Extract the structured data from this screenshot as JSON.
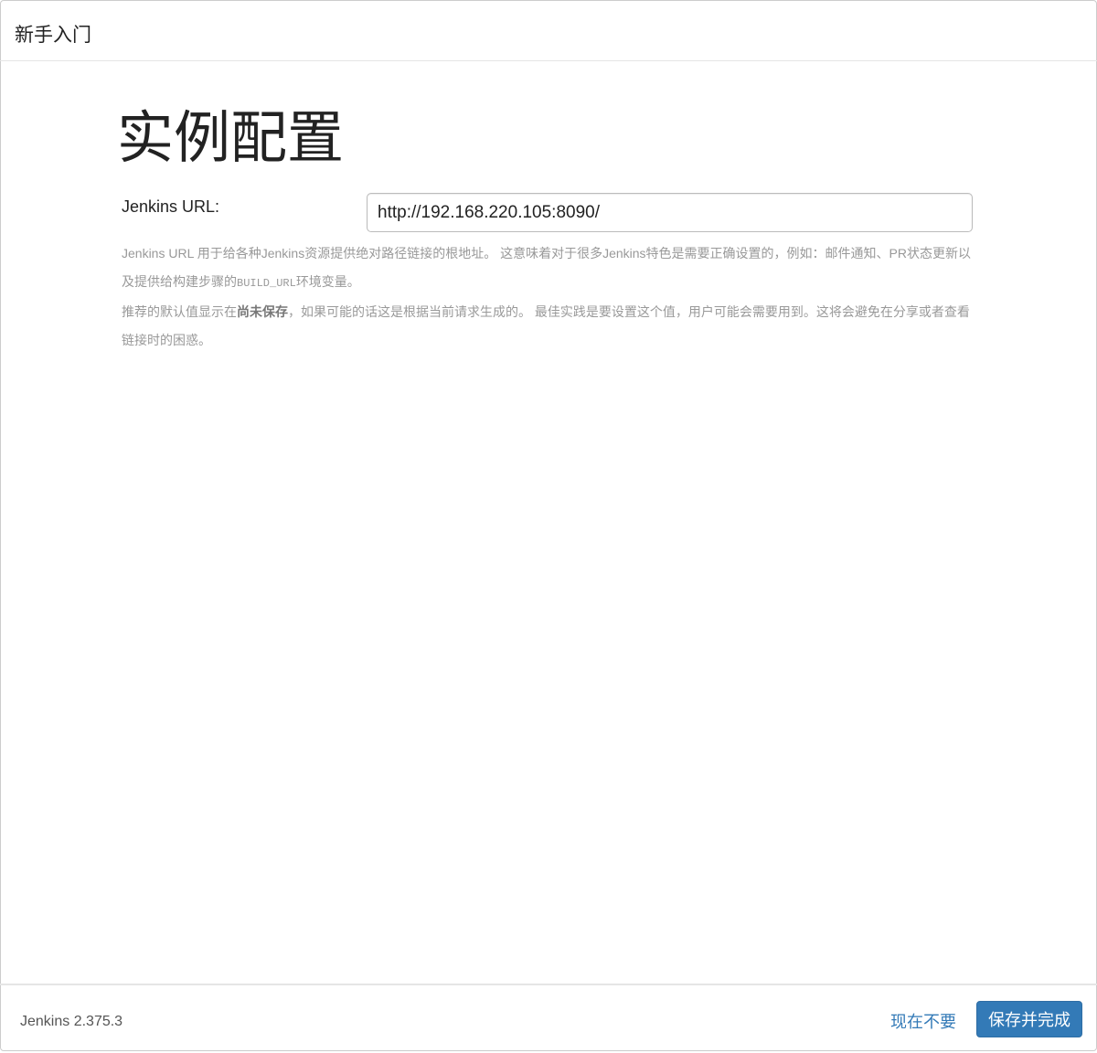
{
  "header": {
    "title": "新手入门"
  },
  "main": {
    "title": "实例配置",
    "url_label": "Jenkins URL:",
    "url_value": "http://192.168.220.105:8090/",
    "help": {
      "p1_a": "Jenkins URL 用于给各种Jenkins资源提供绝对路径链接的根地址。 这意味着对于很多Jenkins特色是需要正确设置的，例如：邮件通知、PR状态更新以及提供给构建步骤的",
      "p1_code": "BUILD_URL",
      "p1_b": "环境变量。",
      "p2_a": "推荐的默认值显示在",
      "p2_bold": "尚未保存",
      "p2_b": "，如果可能的话这是根据当前请求生成的。 最佳实践是要设置这个值，用户可能会需要用到。这将会避免在分享或者查看链接时的困惑。"
    }
  },
  "footer": {
    "version": "Jenkins 2.375.3",
    "skip_label": "现在不要",
    "save_label": "保存并完成"
  }
}
